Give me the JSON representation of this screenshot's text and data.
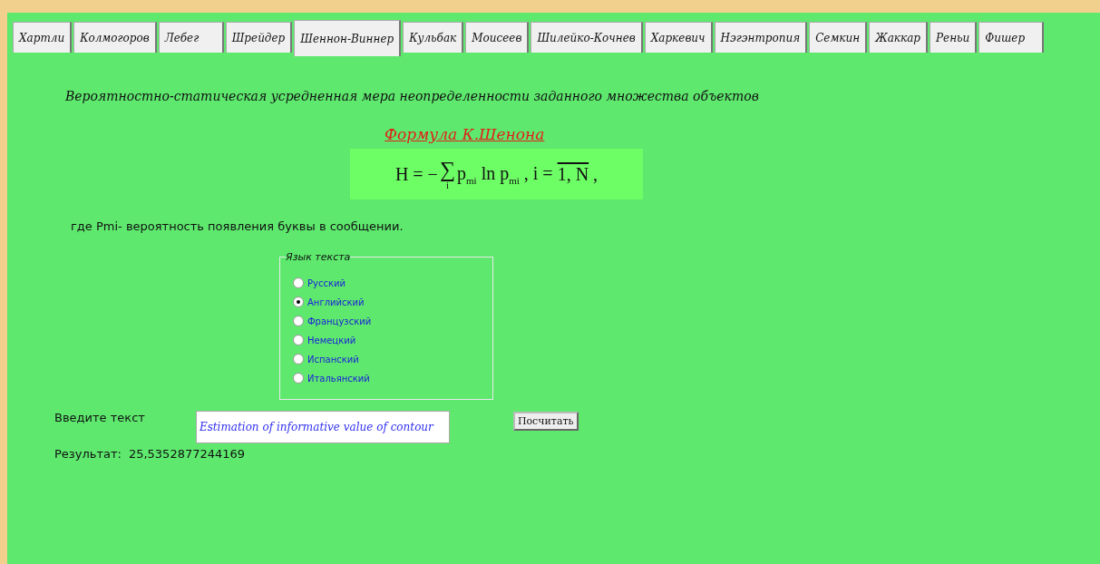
{
  "tabs": [
    {
      "label": "Хартли",
      "selected": false
    },
    {
      "label": "Колмогоров",
      "selected": false
    },
    {
      "label": "Лебег",
      "selected": false
    },
    {
      "label": "Шрейдер",
      "selected": false
    },
    {
      "label": "Шеннон-Виннер",
      "selected": true
    },
    {
      "label": "Кульбак",
      "selected": false
    },
    {
      "label": "Моисеев",
      "selected": false
    },
    {
      "label": "Шилейко-Кочнев",
      "selected": false
    },
    {
      "label": "Харкевич",
      "selected": false
    },
    {
      "label": "Нэгэнтропия",
      "selected": false
    },
    {
      "label": "Семкин",
      "selected": false
    },
    {
      "label": "Жаккар",
      "selected": false
    },
    {
      "label": "Реньи",
      "selected": false
    },
    {
      "label": "Фишер",
      "selected": false
    }
  ],
  "heading": "Вероятностно-статическая усредненная мера неопределенности заданного множества объектов",
  "formula_title": "Формула К.Шенона",
  "formula": {
    "lhs": "H = −",
    "sum": "∑",
    "sum_index": "i",
    "body": "p$_{mi}$ ln p$_{mi}$ , i = ",
    "overlined": "1, N",
    "tail": ","
  },
  "note": "где Pmi- вероятность появления буквы в сообщении.",
  "language_group": {
    "title": "Язык текста",
    "options": [
      {
        "label": "Русский",
        "selected": false
      },
      {
        "label": "Английский",
        "selected": true
      },
      {
        "label": "Французский",
        "selected": false
      },
      {
        "label": "Немецкий",
        "selected": false
      },
      {
        "label": "Испанский",
        "selected": false
      },
      {
        "label": "Итальянский",
        "selected": false
      }
    ]
  },
  "input": {
    "label": "Введите текст",
    "value": "Estimation of informative value of contour"
  },
  "button": "Посчитать",
  "result": {
    "label": "Результат:",
    "value": "25,5352877244169"
  }
}
